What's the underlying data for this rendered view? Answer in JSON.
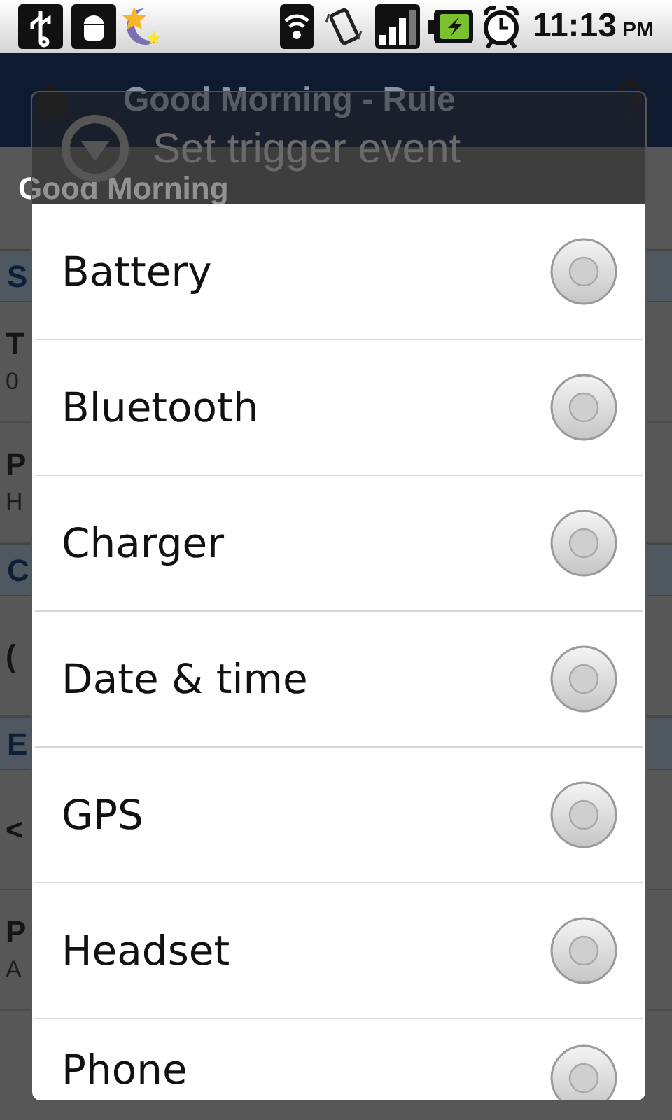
{
  "status_bar": {
    "time": "11:13",
    "meridiem": "PM"
  },
  "app_bar": {
    "title": "Good Morning - Rule"
  },
  "background": {
    "rule_name": "Good Morning",
    "sections": [
      {
        "header": "S",
        "rows": [
          {
            "title": "T",
            "subtitle": "0"
          },
          {
            "title": "P",
            "subtitle": "H"
          }
        ]
      },
      {
        "header": "C",
        "rows": [
          {
            "title": "("
          }
        ]
      },
      {
        "header": "E",
        "rows": [
          {
            "title": "<"
          },
          {
            "title": "P",
            "subtitle": "A"
          }
        ]
      }
    ]
  },
  "dialog": {
    "title": "Set trigger event",
    "options": [
      {
        "label": "Battery",
        "selected": false
      },
      {
        "label": "Bluetooth",
        "selected": false
      },
      {
        "label": "Charger",
        "selected": false
      },
      {
        "label": "Date & time",
        "selected": false
      },
      {
        "label": "GPS",
        "selected": false
      },
      {
        "label": "Headset",
        "selected": false
      },
      {
        "label": "Phone",
        "selected": false
      }
    ]
  }
}
